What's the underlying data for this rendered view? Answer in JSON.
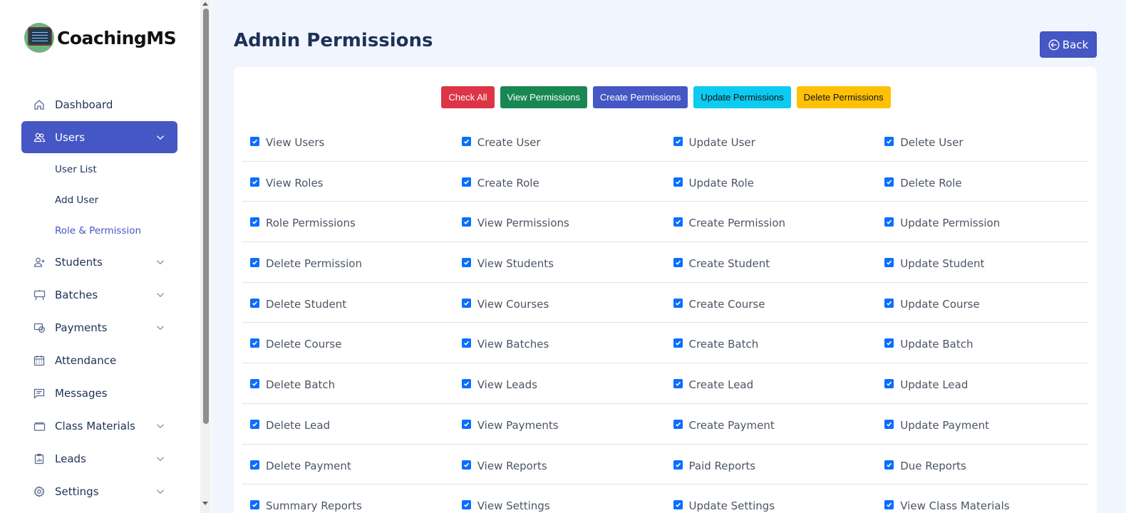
{
  "brand": {
    "name": "CoachingMS"
  },
  "sidebar": {
    "items": [
      {
        "label": "Dashboard",
        "icon": "home-icon"
      },
      {
        "label": "Users",
        "icon": "users-icon"
      },
      {
        "label": "Students",
        "icon": "user-plus-icon"
      },
      {
        "label": "Batches",
        "icon": "easel-icon"
      },
      {
        "label": "Payments",
        "icon": "payments-icon"
      },
      {
        "label": "Attendance",
        "icon": "calendar-icon"
      },
      {
        "label": "Messages",
        "icon": "message-icon"
      },
      {
        "label": "Class Materials",
        "icon": "briefcase-icon"
      },
      {
        "label": "Leads",
        "icon": "clipboard-icon"
      },
      {
        "label": "Settings",
        "icon": "gear-icon"
      }
    ],
    "users_submenu": [
      "User List",
      "Add User",
      "Role & Permission"
    ],
    "active_item": "Users",
    "current_subitem": "Role & Permission"
  },
  "header": {
    "title": "Admin Permissions",
    "back_label": "Back"
  },
  "actions": {
    "check_all": "Check All",
    "view": "View Permissions",
    "create": "Create Permissions",
    "update": "Update Permissions",
    "delete": "Delete Permissions"
  },
  "colors": {
    "primary": "#4557c4",
    "danger": "#dc3545",
    "success": "#198754",
    "info": "#0dcaf0",
    "warning": "#ffc107",
    "checkbox": "#0b6efd"
  },
  "permissions": [
    [
      "View Users",
      "Create User",
      "Update User",
      "Delete User"
    ],
    [
      "View Roles",
      "Create Role",
      "Update Role",
      "Delete Role"
    ],
    [
      "Role Permissions",
      "View Permissions",
      "Create Permission",
      "Update Permission"
    ],
    [
      "Delete Permission",
      "View Students",
      "Create Student",
      "Update Student"
    ],
    [
      "Delete Student",
      "View Courses",
      "Create Course",
      "Update Course"
    ],
    [
      "Delete Course",
      "View Batches",
      "Create Batch",
      "Update Batch"
    ],
    [
      "Delete Batch",
      "View Leads",
      "Create Lead",
      "Update Lead"
    ],
    [
      "Delete Lead",
      "View Payments",
      "Create Payment",
      "Update Payment"
    ],
    [
      "Delete Payment",
      "View Reports",
      "Paid Reports",
      "Due Reports"
    ],
    [
      "Summary Reports",
      "View Settings",
      "Update Settings",
      "View Class Materials"
    ]
  ],
  "all_checked": true
}
